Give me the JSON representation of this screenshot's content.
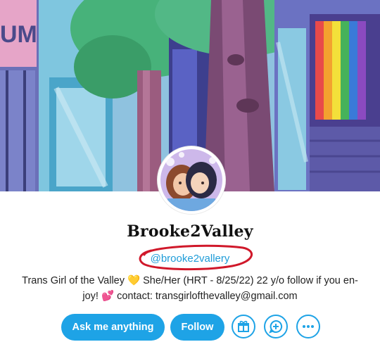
{
  "profile": {
    "display_name": "Brooke2Valley",
    "handle": "@brooke2vallery",
    "bio_line1_a": "Trans Girl of the Valley",
    "bio_line1_b": "She/Her (HRT - 8/25/22) 22 y/o follow if you en-",
    "bio_line2_a": "joy!",
    "bio_line2_b": "contact: transgirlofthevalley@gmail.com",
    "emoji_heart": "💛",
    "emoji_hearts": "💕"
  },
  "actions": {
    "ask_label": "Ask me anything",
    "follow_label": "Follow",
    "icons": [
      "gift-icon",
      "chat-plus-icon",
      "more-icon"
    ]
  },
  "colors": {
    "accent": "#1ea3e6",
    "handle_text": "#1e9cd8",
    "annotation": "#d0182a"
  }
}
